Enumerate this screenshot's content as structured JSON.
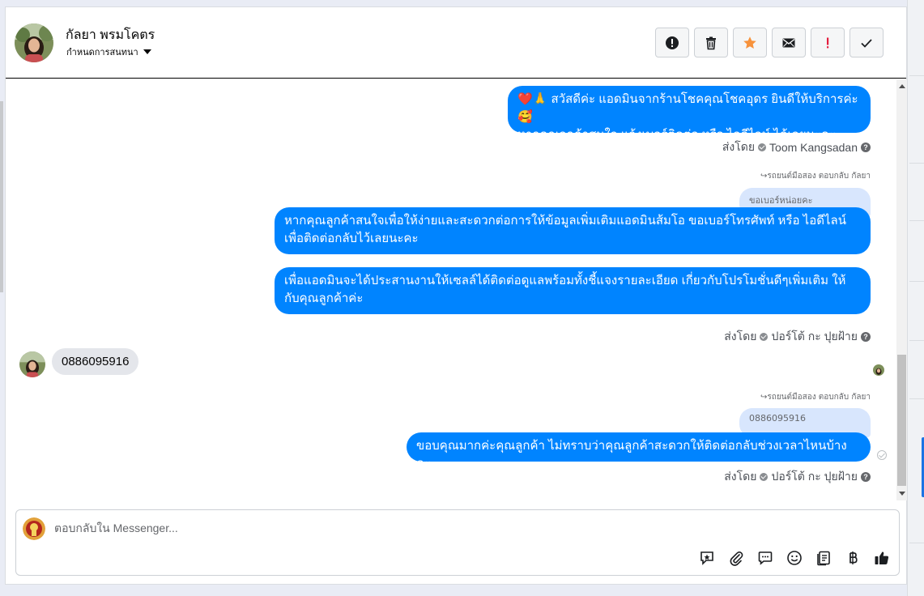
{
  "header": {
    "contact_name": "กัลยา พรมโคตร",
    "assign_label": "กำหนดการสนทนา",
    "actions": [
      {
        "name": "mark-spam",
        "icon": "alert-circle-icon"
      },
      {
        "name": "delete",
        "icon": "trash-icon"
      },
      {
        "name": "star",
        "icon": "star-icon",
        "color": "#f7923b"
      },
      {
        "name": "mark-unread",
        "icon": "envelope-icon"
      },
      {
        "name": "follow-up",
        "icon": "exclamation-icon",
        "color": "#e41e3f"
      },
      {
        "name": "mark-done",
        "icon": "check-icon"
      }
    ]
  },
  "messages": {
    "m1": {
      "line1": "❤️🙏 สวัสดีค่ะ แอดมินจากร้านโชคคุณโชคอุดร ยินดีให้บริการค่ะ🥰",
      "line2": "หากคุณลูกค้าสนใจ แจ้งเบอร์ติดต่อ หรือ ไอดีไลน์ ได้เลยนะคะ",
      "sent_by_prefix": "ส่งโดย",
      "sent_by_name": "Toom Kangsadan"
    },
    "reply1": {
      "label": "รถยนต์มือสอง ตอบกลับ กัลยา",
      "quoted": "ขอเบอร์หน่อยคะ"
    },
    "m2": {
      "line1": "หากคุณลูกค้าสนใจเพื่อให้ง่ายและสะดวกต่อการให้ข้อมูลเพิ่มเติมแอดมินส้มโอ ขอเบอร์โทรศัพท์ หรือ ไอดีไลน์",
      "line2": "เพื่อติดต่อกลับไว้เลยนะคะ"
    },
    "m3": {
      "line1": "เพื่อแอดมินจะได้ประสานงานให้เซลล์ได้ติดต่อดูแลพร้อมทั้งชี้แจงรายละเอียด เกี่ยวกับโปรโมชั่นดีๆเพิ่มเติม ให้",
      "line2": "กับคุณลูกค้าค่ะ",
      "sent_by_prefix": "ส่งโดย",
      "sent_by_name": "ปอร์โต้ กะ ปุยฝ้าย"
    },
    "incoming": {
      "text": "0886095916"
    },
    "reply2": {
      "label": "รถยนต์มือสอง ตอบกลับ กัลยา",
      "quoted": "0886095916"
    },
    "m4": {
      "line1": "ขอบคุณมากค่ะคุณลูกค้า ไม่ทราบว่าคุณลูกค้าสะดวกให้ติดต่อกลับช่วงเวลาไหนบ้างคะ",
      "sent_by_prefix": "ส่งโดย",
      "sent_by_name": "ปอร์โต้ กะ ปุยฝ้าย"
    }
  },
  "composer": {
    "placeholder": "ตอบกลับใน Messenger...",
    "tools": [
      "saved-reply-icon",
      "attachment-icon",
      "chat-bubble-icon",
      "emoji-icon",
      "notes-icon",
      "baht-icon",
      "thumbs-up-icon"
    ]
  },
  "colors": {
    "accent": "#0084ff",
    "incoming_bubble": "#e4e6eb",
    "quote_bubble": "#d8e6fd"
  }
}
